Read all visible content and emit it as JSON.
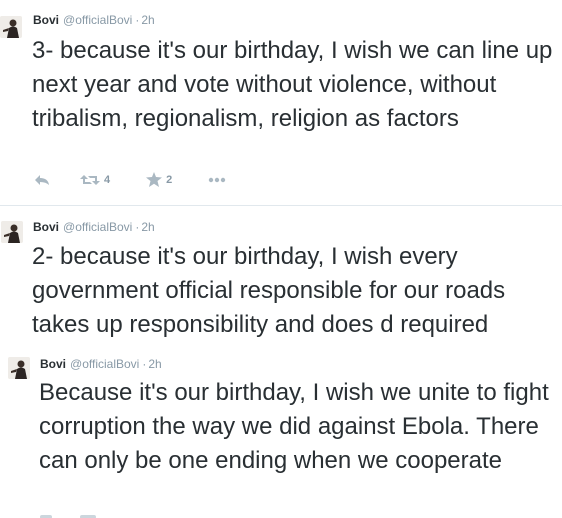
{
  "tweets": [
    {
      "name": "Bovi",
      "handle": "@officialBovi",
      "separator": "·",
      "time": "2h",
      "text": "3- because it's our birthday, I wish we can line up next year and vote without violence, without tribalism, regionalism, religion as factors",
      "retweets": "4",
      "favorites": "2"
    },
    {
      "name": "Bovi",
      "handle": "@officialBovi",
      "separator": "·",
      "time": "2h",
      "text": "2- because it's our birthday, I wish every government official responsible for our roads takes up responsibility and does d required"
    },
    {
      "name": "Bovi",
      "handle": "@officialBovi",
      "separator": "·",
      "time": "2h",
      "text": "Because it's our birthday, I wish we unite to fight corruption the way we did against Ebola. There can only be one ending when we cooperate"
    }
  ],
  "icons": {
    "reply": "reply-icon",
    "retweet": "retweet-icon",
    "favorite": "star-icon",
    "more": "more-icon"
  },
  "colors": {
    "text": "#292f33",
    "muted": "#8899a6",
    "divider": "#e1e8ed"
  }
}
